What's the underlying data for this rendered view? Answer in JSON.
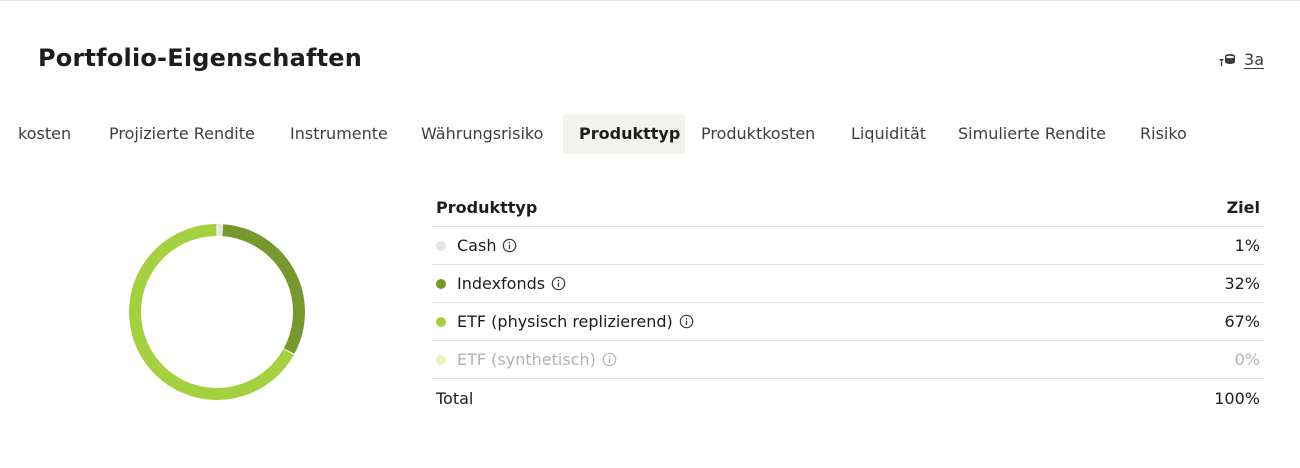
{
  "header": {
    "title": "Portfolio-Eigenschaften",
    "pillar_label": "3a",
    "pillar_icon": "coins-with-arrow-icon"
  },
  "tabs": [
    {
      "label": "kosten",
      "active": false
    },
    {
      "label": "Projizierte Rendite",
      "active": false
    },
    {
      "label": "Instrumente",
      "active": false
    },
    {
      "label": "Währungsrisiko",
      "active": false
    },
    {
      "label": "Produkttyp",
      "active": true
    },
    {
      "label": "Produktkosten",
      "active": false
    },
    {
      "label": "Liquidität",
      "active": false
    },
    {
      "label": "Simulierte Rendite",
      "active": false
    },
    {
      "label": "Risiko",
      "active": false
    }
  ],
  "table": {
    "header_left": "Produkttyp",
    "header_right": "Ziel",
    "rows": [
      {
        "label": "Cash",
        "value": "1%",
        "color": "#e4e4e4",
        "icon": "info-circle-icon",
        "muted": false
      },
      {
        "label": "Indexfonds",
        "value": "32%",
        "color": "#76992e",
        "icon": "info-circle-icon",
        "muted": false
      },
      {
        "label": "ETF (physisch replizierend)",
        "value": "67%",
        "color": "#a6d13f",
        "icon": "info-circle-icon",
        "muted": false
      },
      {
        "label": "ETF (synthetisch)",
        "value": "0%",
        "color": "#e6f5b8",
        "icon": "info-circle-icon",
        "muted": true
      }
    ],
    "total_label": "Total",
    "total_value": "100%"
  },
  "chart_data": {
    "type": "pie",
    "donut": true,
    "categories": [
      "Cash",
      "Indexfonds",
      "ETF (physisch replizierend)",
      "ETF (synthetisch)"
    ],
    "values": [
      1,
      32,
      67,
      0
    ],
    "colors": [
      "#e4e4e4",
      "#76992e",
      "#a6d13f",
      "#e6f5b8"
    ]
  }
}
